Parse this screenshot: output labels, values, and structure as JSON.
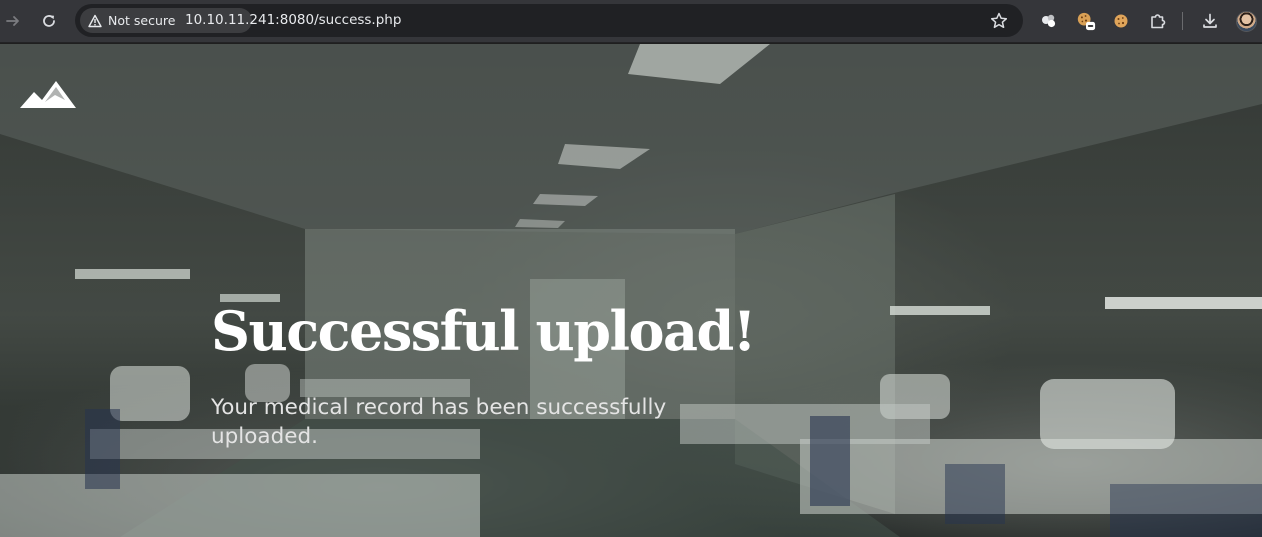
{
  "browser": {
    "security_label": "Not secure",
    "url": "10.10.11.241:8080/success.php",
    "icons": {
      "back": "arrow-right-icon",
      "reload": "reload-icon",
      "security": "warning-triangle-icon",
      "bookmark": "star-icon",
      "extensions": [
        "extension-blob-icon",
        "cookie-extension-icon",
        "cookie-icon",
        "puzzle-icon"
      ],
      "download": "download-icon",
      "profile": "avatar"
    }
  },
  "page": {
    "logo": "mountain-logo",
    "headline": "Successful upload!",
    "message": "Your medical record has been successfully uploaded."
  },
  "colors": {
    "toolbar": "#35363a",
    "omnibox": "#202124",
    "headline": "#ffffff",
    "message": "#e4e4e4"
  }
}
